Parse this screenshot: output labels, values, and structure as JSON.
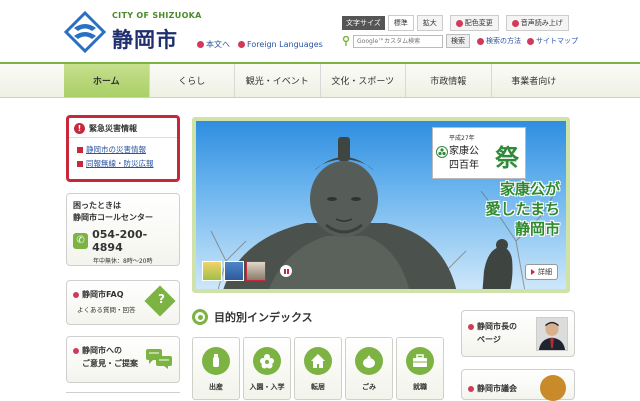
{
  "header": {
    "city_en": "CITY OF SHIZUOKA",
    "city_jp": "静岡市",
    "links": [
      {
        "label": "本文へ"
      },
      {
        "label": "Foreign Languages"
      }
    ],
    "text_size": {
      "label": "文字サイズ",
      "standard": "標準",
      "large": "拡大"
    },
    "color_change": "配色変更",
    "read_aloud": "音声読み上げ",
    "search": {
      "placeholder": "Google™カスタム検索",
      "button": "検索"
    },
    "search_help": "検索の方法",
    "sitemap": "サイトマップ"
  },
  "nav": {
    "items": [
      {
        "label": "ホーム"
      },
      {
        "label": "くらし"
      },
      {
        "label": "観光・イベント"
      },
      {
        "label": "文化・スポーツ"
      },
      {
        "label": "市政情報"
      },
      {
        "label": "事業者向け"
      }
    ]
  },
  "emergency": {
    "title": "緊急災害情報",
    "links": [
      {
        "label": "静岡市の災害情報"
      },
      {
        "label": "同報無線・防災広報"
      }
    ]
  },
  "call_center": {
    "line1": "困ったときは",
    "line2": "静岡市コールセンター",
    "phone": "054-200-4894",
    "hours": "年中無休：8時〜20時"
  },
  "faq": {
    "title": "静岡市FAQ",
    "sub": "よくある質問・回答",
    "icon_text": "?"
  },
  "opinion": {
    "line1": "静岡市への",
    "line2": "ご意見・ご提案"
  },
  "banner": {
    "heisei": "平成27年",
    "ieyasu": "家康公",
    "four_hundred": "四百年",
    "matsuri": "祭",
    "slogan1": "家康公が",
    "slogan2": "愛したまち",
    "slogan3": "静岡市",
    "detail": "詳細"
  },
  "index": {
    "title": "目的別インデックス",
    "items": [
      {
        "label": "出産"
      },
      {
        "label": "入園・入学"
      },
      {
        "label": "転居"
      },
      {
        "label": "ごみ"
      },
      {
        "label": "就職"
      }
    ]
  },
  "mayor": {
    "line1": "静岡市長の",
    "line2": "ページ"
  },
  "council": {
    "title": "静岡市議会"
  },
  "colors": {
    "accent_green": "#7cb342",
    "emergency_red": "#c7283a",
    "navy": "#1e2e6e",
    "link_blue": "#2a53a0"
  }
}
